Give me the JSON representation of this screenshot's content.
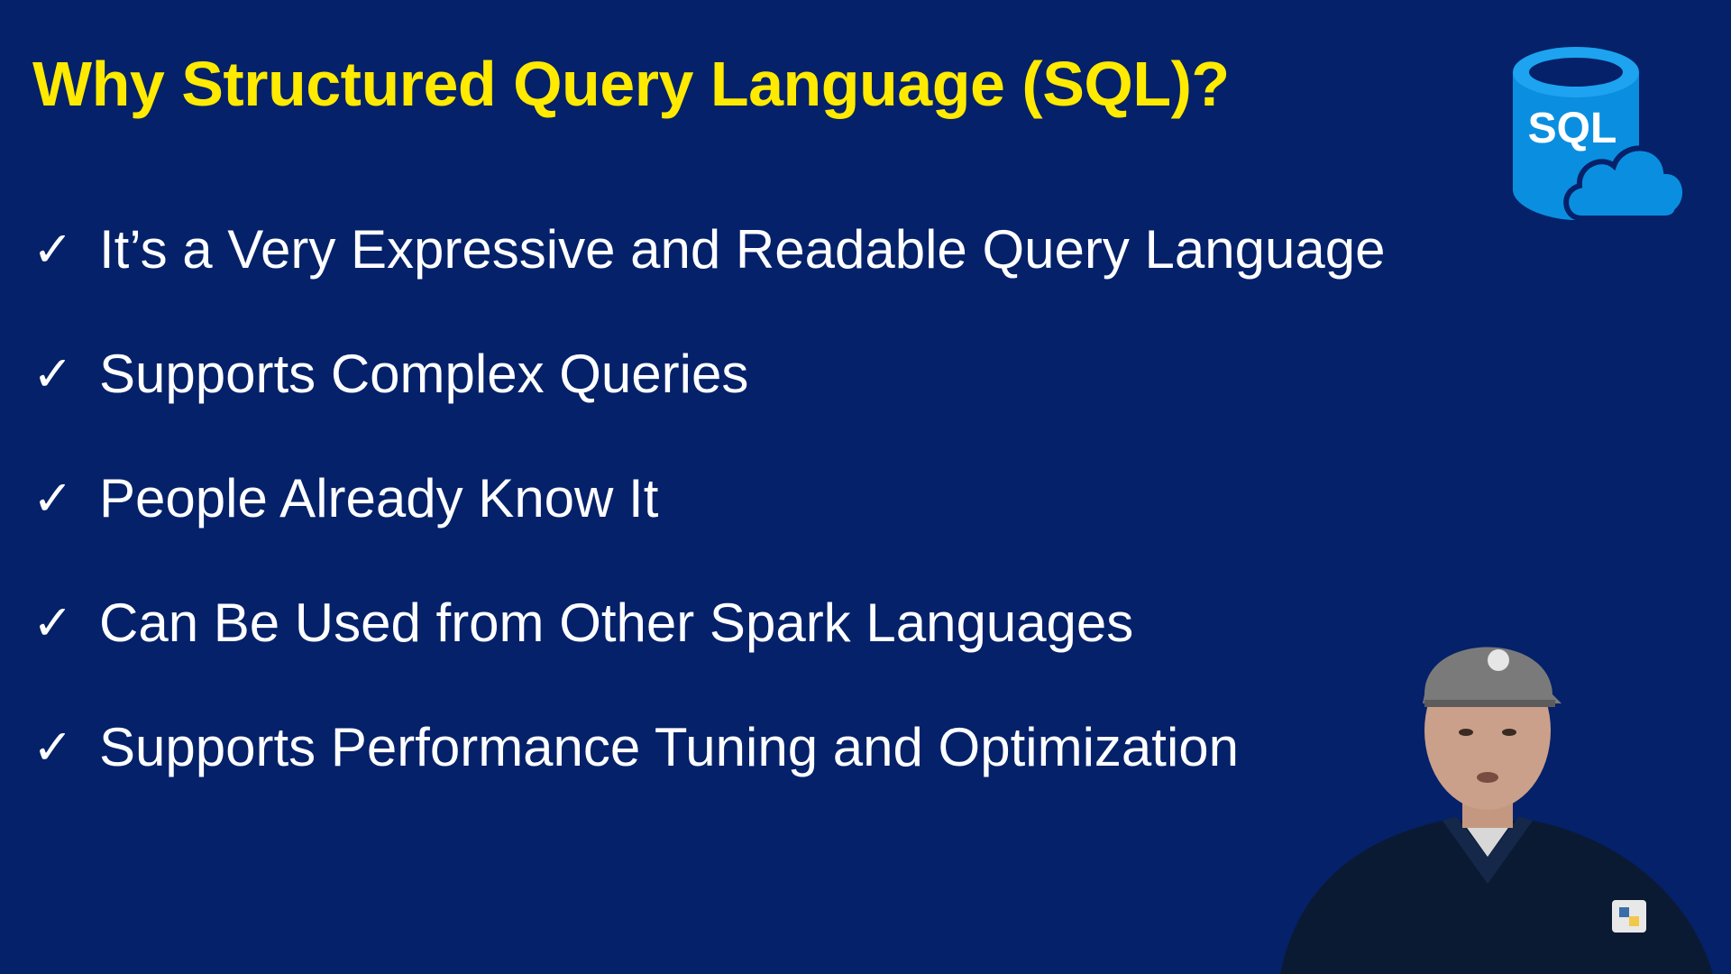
{
  "slide": {
    "title": "Why Structured Query Language (SQL)?",
    "check_glyph": "✓",
    "bullets": [
      {
        "text": "It’s a Very Expressive and Readable Query Language"
      },
      {
        "text": "Supports Complex Queries"
      },
      {
        "text": "People Already Know It"
      },
      {
        "text": "Can Be Used from Other Spark Languages"
      },
      {
        "text": "Supports Performance Tuning and Optimization"
      }
    ]
  },
  "logo": {
    "icon": "sql-database-cloud-icon",
    "label": "SQL"
  },
  "presenter": {
    "icon": "presenter-video-overlay"
  },
  "colors": {
    "background": "#04216a",
    "title": "#ffea00",
    "bullet_text": "#ffffff",
    "logo_blue": "#0a8fe0"
  }
}
